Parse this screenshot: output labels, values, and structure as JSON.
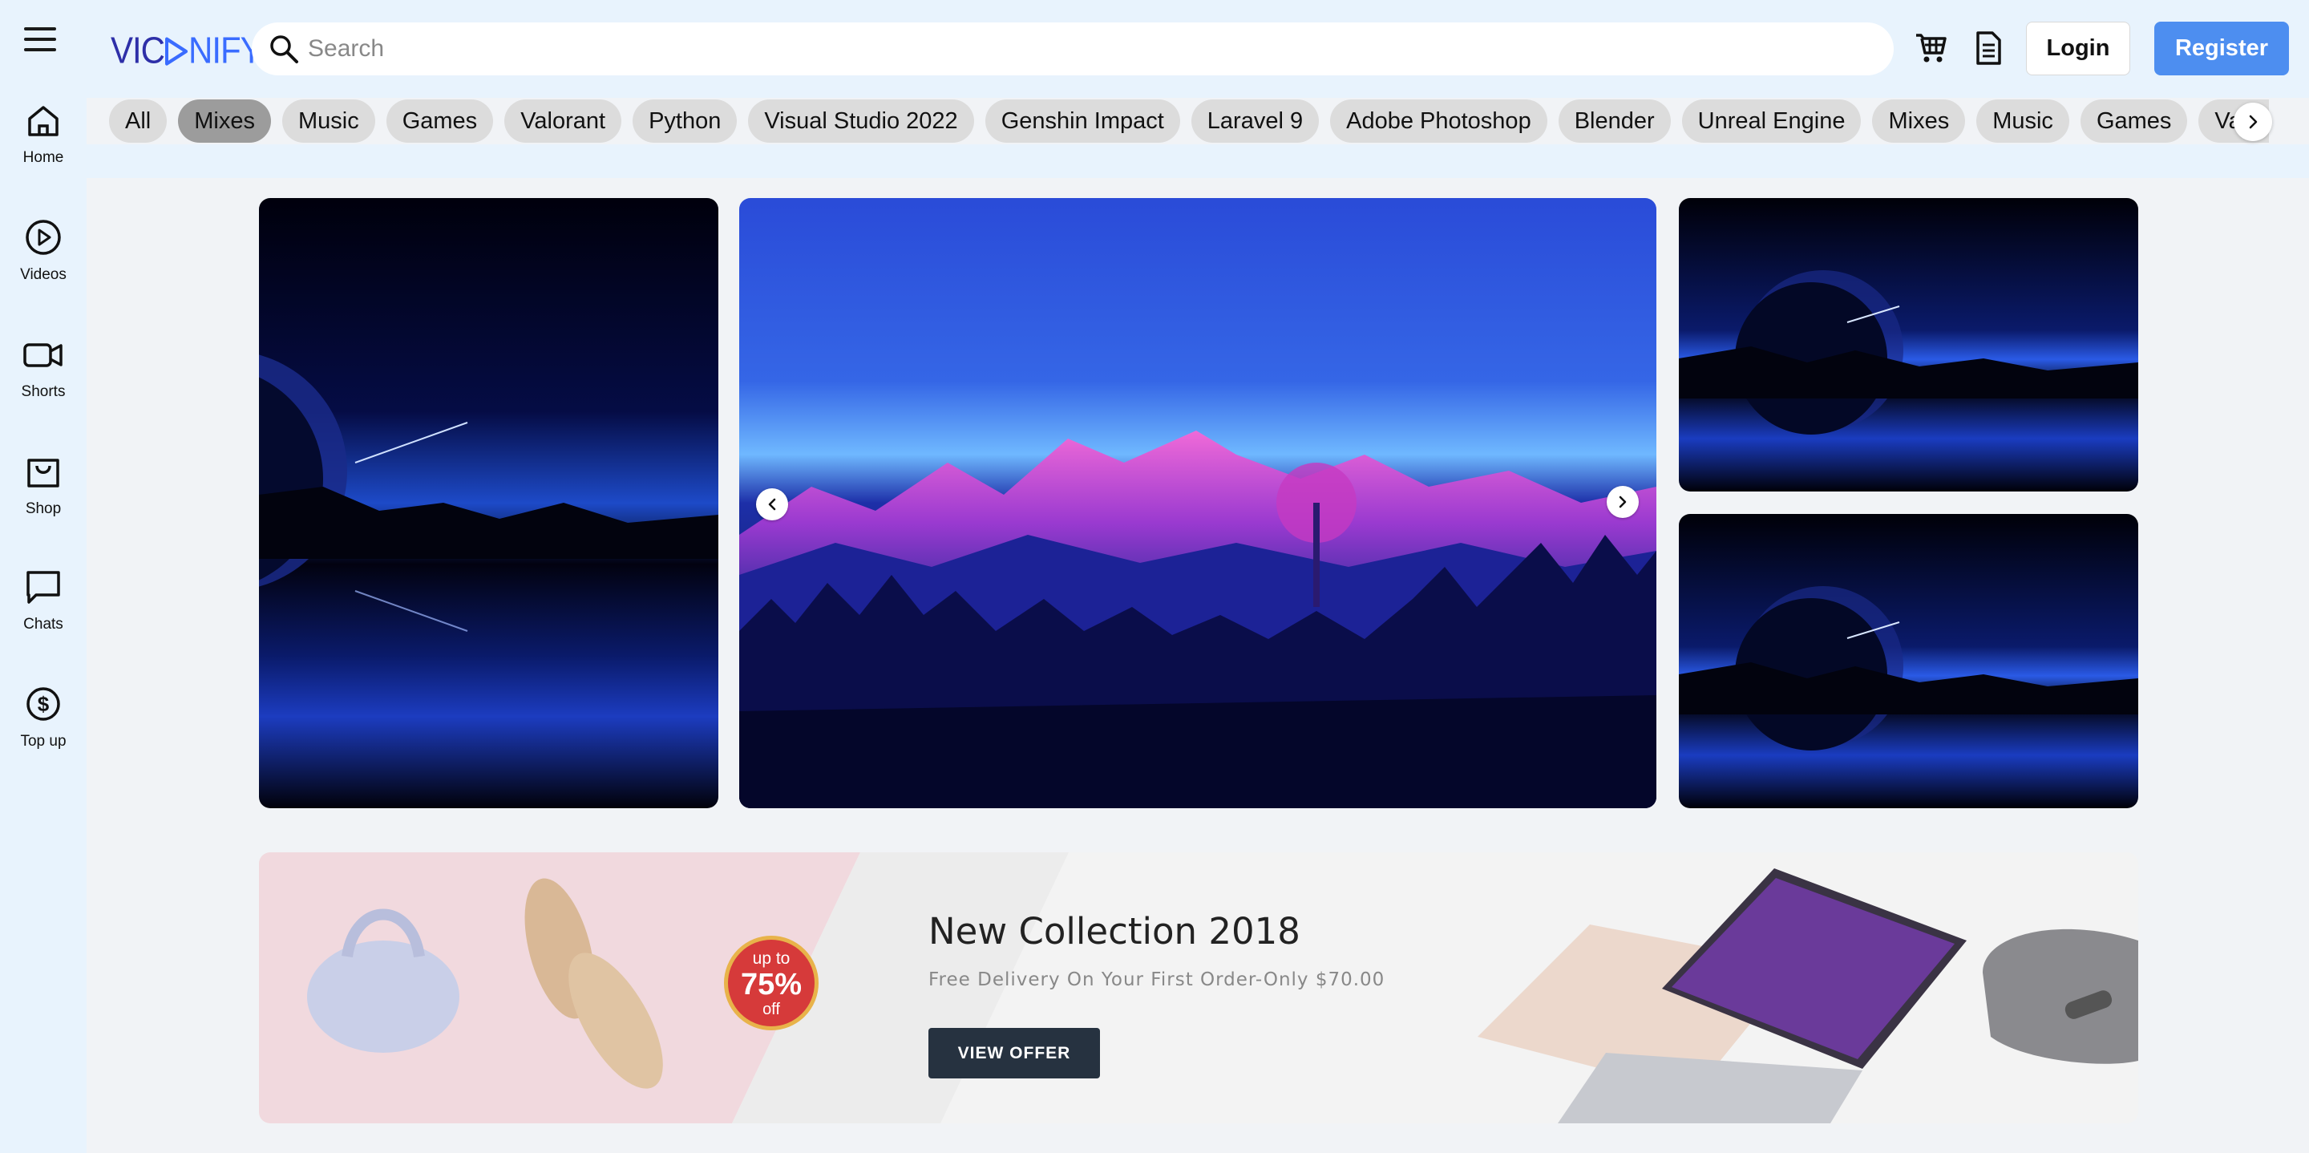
{
  "app": {
    "logo_prefix": "VIC",
    "logo_suffix": "NIFY",
    "brand_color": "#2e2fa8",
    "accent_color": "#4d8ef0"
  },
  "header": {
    "search_placeholder": "Search",
    "cart_icon": "cart-icon",
    "document_icon": "document-icon",
    "login_label": "Login",
    "register_label": "Register"
  },
  "chips": [
    {
      "label": "All",
      "active": false
    },
    {
      "label": "Mixes",
      "active": true
    },
    {
      "label": "Music",
      "active": false
    },
    {
      "label": "Games",
      "active": false
    },
    {
      "label": "Valorant",
      "active": false
    },
    {
      "label": "Python",
      "active": false
    },
    {
      "label": "Visual Studio 2022",
      "active": false
    },
    {
      "label": "Genshin Impact",
      "active": false
    },
    {
      "label": "Laravel 9",
      "active": false
    },
    {
      "label": "Adobe Photoshop",
      "active": false
    },
    {
      "label": "Blender",
      "active": false
    },
    {
      "label": "Unreal Engine",
      "active": false
    },
    {
      "label": "Mixes",
      "active": false
    },
    {
      "label": "Music",
      "active": false
    },
    {
      "label": "Games",
      "active": false
    },
    {
      "label": "Valorant",
      "active": false
    }
  ],
  "sidebar": {
    "items": [
      {
        "label": "Home",
        "icon": "home-icon"
      },
      {
        "label": "Videos",
        "icon": "play-circle-icon"
      },
      {
        "label": "Shorts",
        "icon": "video-camera-icon"
      },
      {
        "label": "Shop",
        "icon": "shopping-bag-icon"
      },
      {
        "label": "Chats",
        "icon": "chat-bubble-icon"
      },
      {
        "label": "Top up",
        "icon": "dollar-coin-icon"
      }
    ]
  },
  "banner": {
    "title": "New Collection 2018",
    "subtitle": "Free Delivery On Your First Order-Only $70.00",
    "button_label": "VIEW OFFER",
    "badge_top": "up to",
    "badge_value": "75%",
    "badge_bottom": "off"
  }
}
